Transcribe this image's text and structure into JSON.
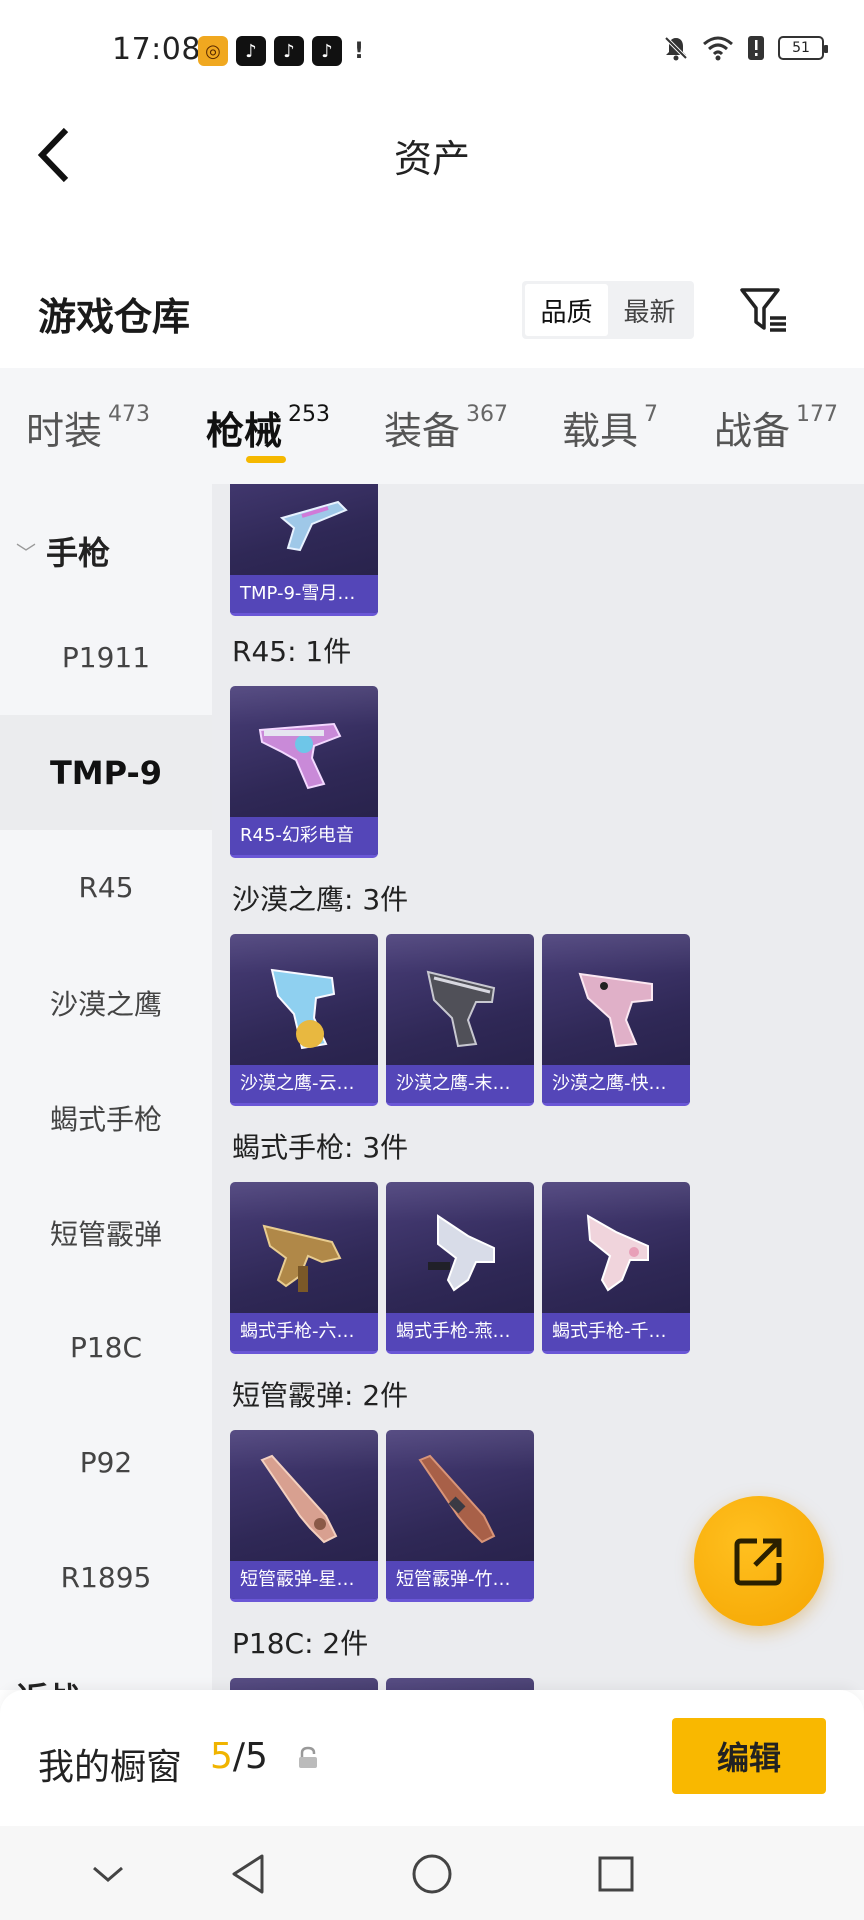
{
  "status_bar": {
    "time": "17:08",
    "battery": "51",
    "app_icons": [
      "app-icon-yellow",
      "tiktok-icon",
      "tiktok-icon",
      "tiktok-icon",
      "alert-icon"
    ],
    "right_icons": [
      "mute-bell-icon",
      "wifi-icon",
      "alert-icon",
      "battery-icon"
    ]
  },
  "header": {
    "title": "资产",
    "back_icon": "back-chevron-icon"
  },
  "warehouse": {
    "title": "游戏仓库",
    "sort_options": [
      {
        "label": "品质",
        "active": true
      },
      {
        "label": "最新",
        "active": false
      }
    ],
    "filter_icon": "filter-icon"
  },
  "tabs": [
    {
      "label": "时装",
      "count": "473",
      "active": false
    },
    {
      "label": "枪械",
      "count": "253",
      "active": true
    },
    {
      "label": "装备",
      "count": "367",
      "active": false
    },
    {
      "label": "载具",
      "count": "7",
      "active": false
    },
    {
      "label": "战备",
      "count": "177",
      "active": false
    }
  ],
  "sidebar": {
    "group": "手枪",
    "items": [
      "P1911",
      "TMP-9",
      "R45",
      "沙漠之鹰",
      "蝎式手枪",
      "短管霰弹",
      "P18C",
      "P92",
      "R1895"
    ],
    "active_item": "TMP-9",
    "next_group": "近战"
  },
  "content": {
    "top_items": [
      "TMP-9-雪月…"
    ],
    "categories": [
      {
        "label": "R45: 1件",
        "items": [
          "R45-幻彩电音"
        ]
      },
      {
        "label": "沙漠之鹰: 3件",
        "items": [
          "沙漠之鹰-云…",
          "沙漠之鹰-末…",
          "沙漠之鹰-快…"
        ]
      },
      {
        "label": "蝎式手枪: 3件",
        "items": [
          "蝎式手枪-六…",
          "蝎式手枪-燕…",
          "蝎式手枪-千…"
        ]
      },
      {
        "label": "短管霰弹: 2件",
        "items": [
          "短管霰弹-星…",
          "短管霰弹-竹…"
        ]
      },
      {
        "label": "P18C: 2件",
        "items": []
      }
    ]
  },
  "fab": {
    "icon": "share-export-icon"
  },
  "showcase": {
    "label": "我的橱窗",
    "current": "5",
    "separator": "/",
    "total": "5",
    "lock_icon": "lock-icon"
  },
  "edit_button": "编辑",
  "nav": {
    "icons": [
      "chevron-down-icon",
      "back-triangle-icon",
      "home-circle-icon",
      "recents-square-icon"
    ]
  }
}
